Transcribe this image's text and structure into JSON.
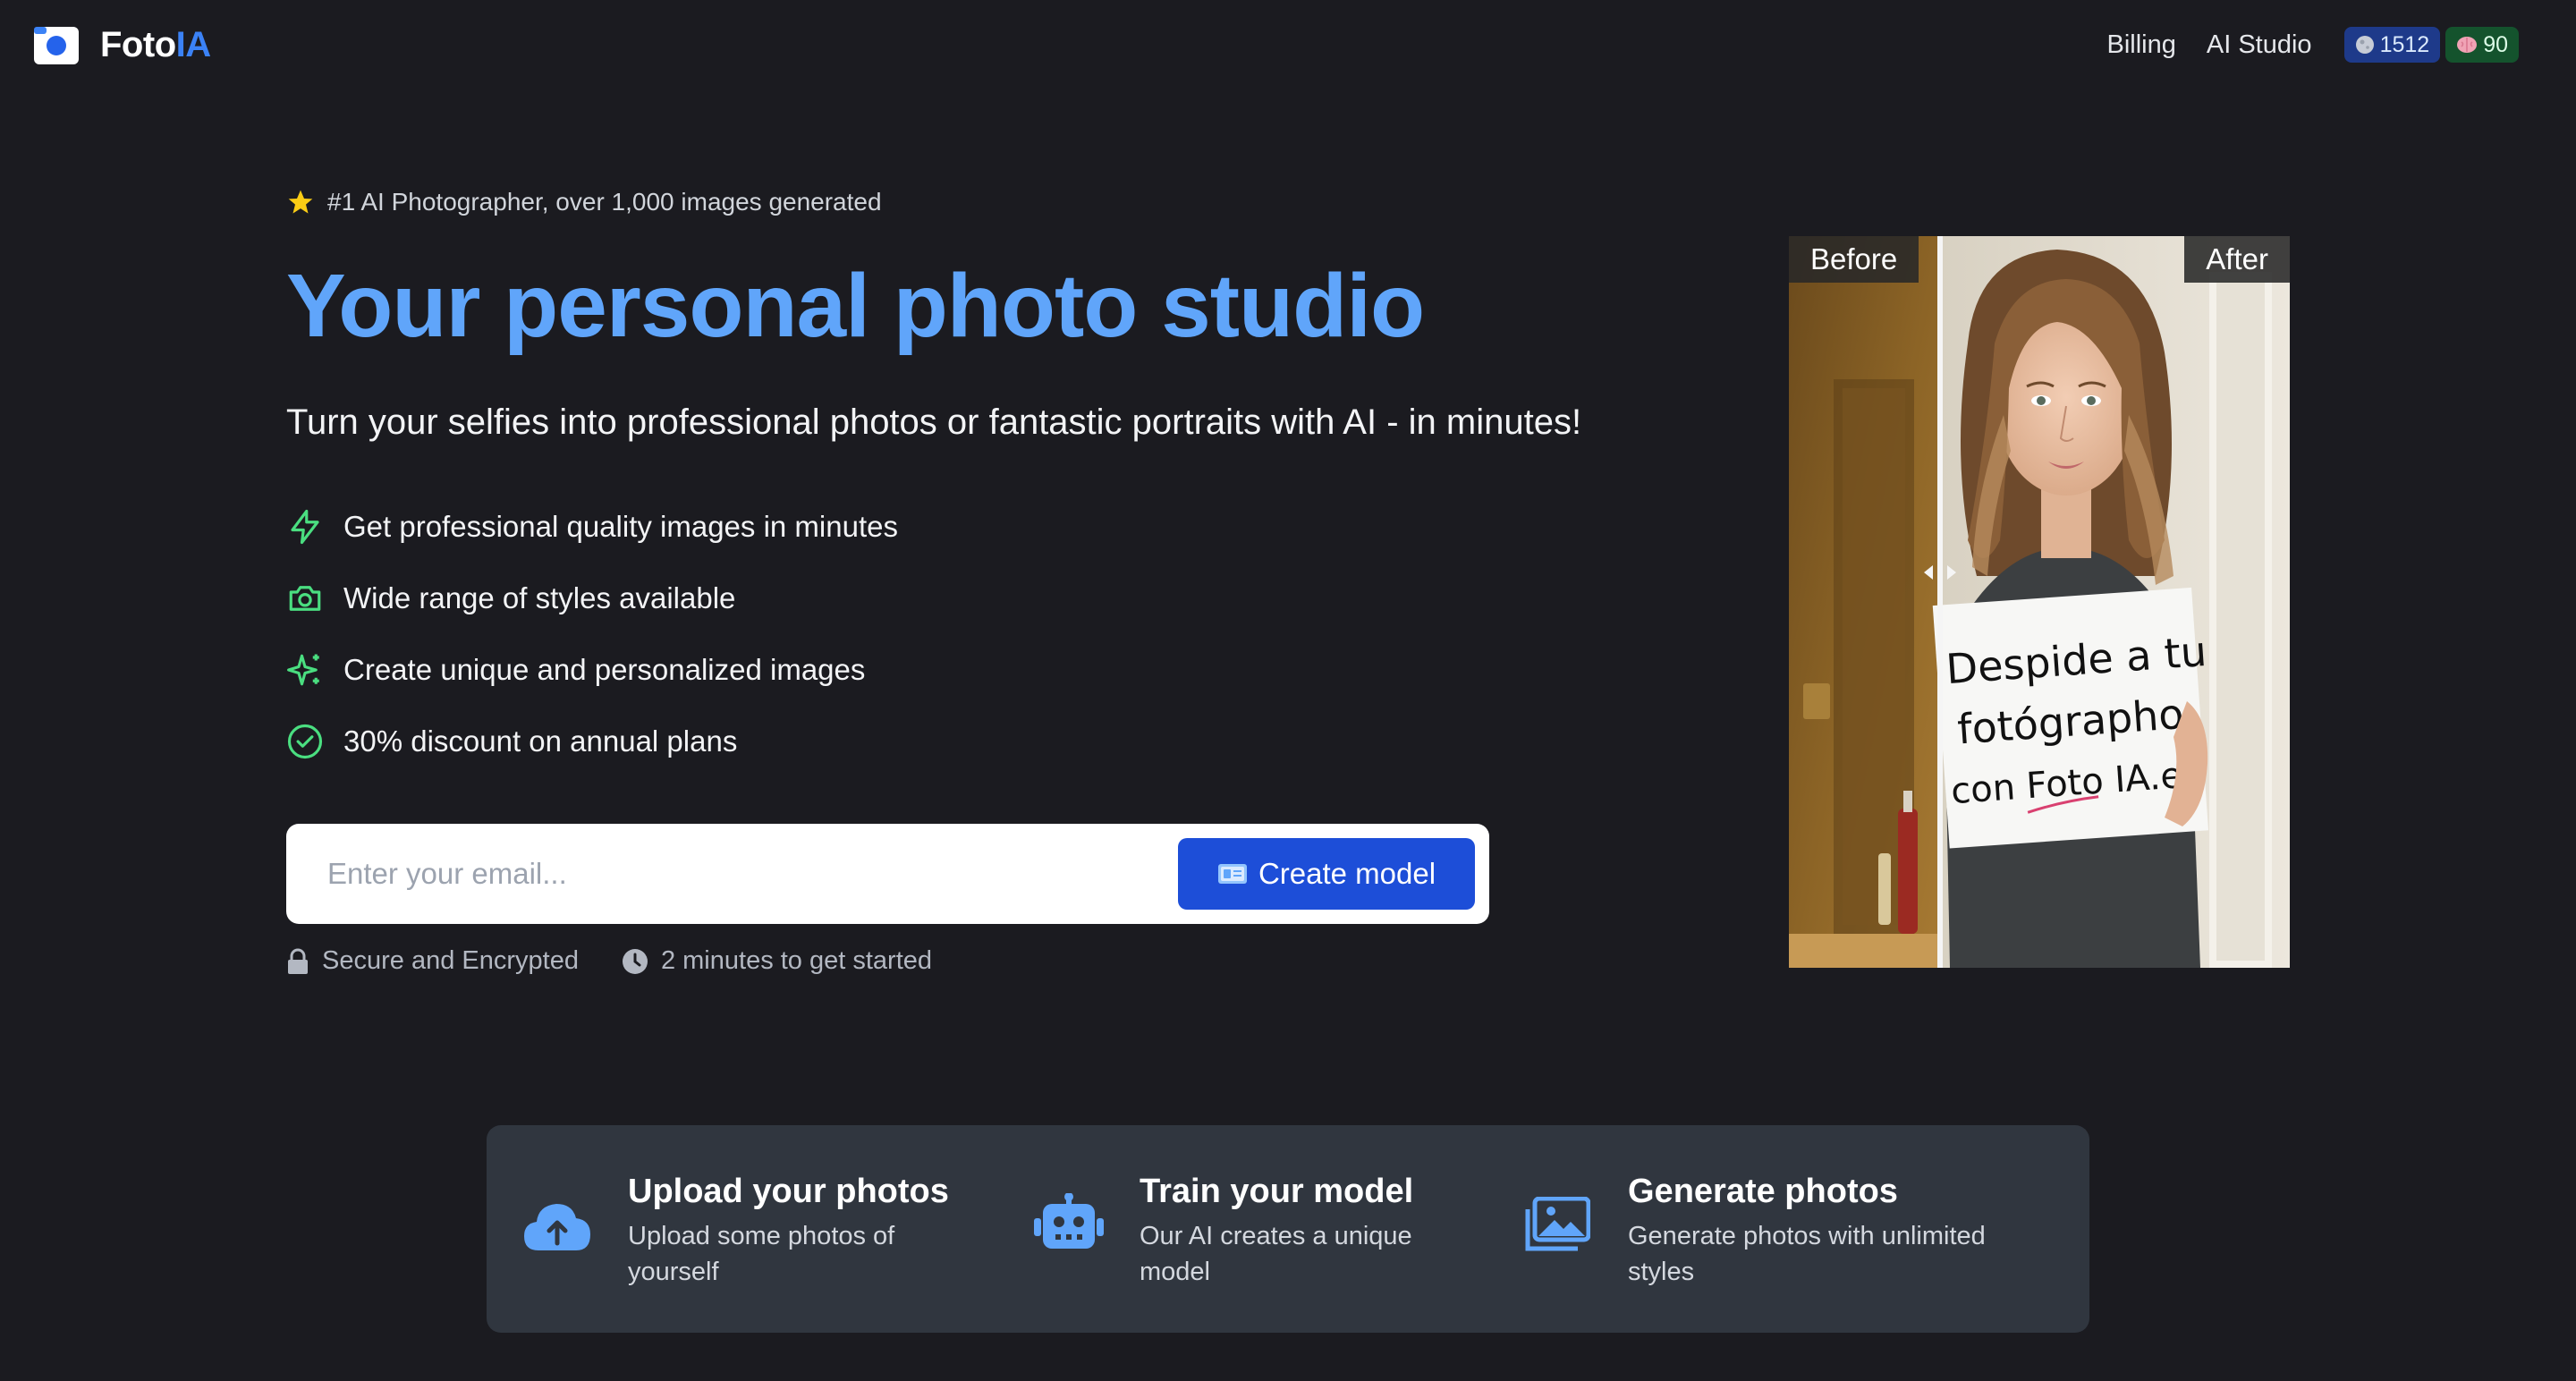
{
  "header": {
    "brand": {
      "name_main": "Foto",
      "name_accent": "IA"
    },
    "nav": {
      "billing": "Billing",
      "studio": "AI Studio"
    },
    "badges": [
      {
        "icon": "moon-icon",
        "value": "1512"
      },
      {
        "icon": "brain-icon",
        "value": "90"
      }
    ]
  },
  "hero": {
    "rating_text": "#1 AI Photographer, over 1,000 images generated",
    "title": "Your personal photo studio",
    "subtitle": "Turn your selfies into professional photos or fantastic portraits with AI - in minutes!",
    "features": [
      {
        "icon": "lightning-icon",
        "text": "Get professional quality images in minutes"
      },
      {
        "icon": "camera-icon",
        "text": "Wide range of styles available"
      },
      {
        "icon": "sparkles-icon",
        "text": "Create unique and personalized images"
      },
      {
        "icon": "check-circle-icon",
        "text": "30% discount on annual plans"
      }
    ],
    "email_placeholder": "Enter your email...",
    "email_value": "",
    "cta_label": "Create model",
    "trust": {
      "secure": "Secure and Encrypted",
      "time": "2 minutes to get started"
    }
  },
  "compare": {
    "before_label": "Before",
    "after_label": "After",
    "sign_lines": [
      "Despide a tu",
      "fotógrapho",
      "con Foto IA.es"
    ]
  },
  "steps": [
    {
      "icon": "cloud-upload-icon",
      "title": "Upload your photos",
      "description": "Upload some photos of yourself"
    },
    {
      "icon": "robot-icon",
      "title": "Train your model",
      "description": "Our AI creates a unique model"
    },
    {
      "icon": "images-icon",
      "title": "Generate photos",
      "description": "Generate photos with unlimited styles"
    }
  ],
  "colors": {
    "background": "#1b1b20",
    "accent": "#60a5fa",
    "brand_blue": "#3b82f6",
    "feature_icon_green": "#4ade80",
    "button_blue": "#1d4ed8",
    "steps_panel": "#30363f"
  }
}
